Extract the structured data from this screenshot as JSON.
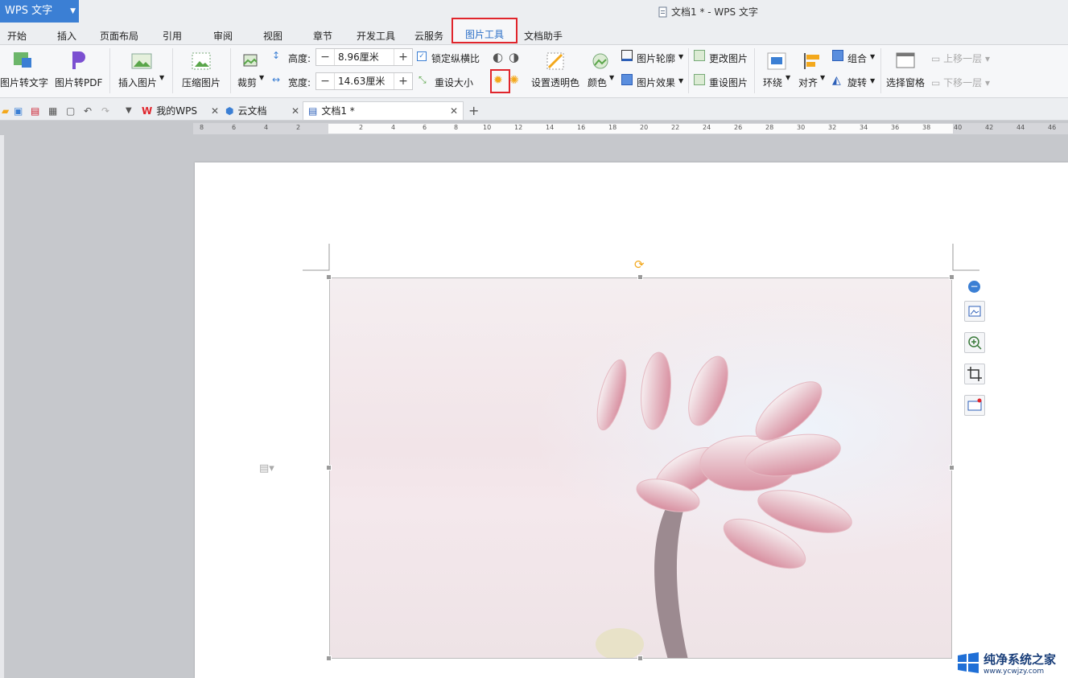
{
  "app": {
    "name": "WPS 文字",
    "window_title": "文档1 * - WPS 文字"
  },
  "menu_tabs": [
    "开始",
    "插入",
    "页面布局",
    "引用",
    "审阅",
    "视图",
    "章节",
    "开发工具",
    "云服务",
    "图片工具",
    "文档助手"
  ],
  "active_tab": "图片工具",
  "ribbon": {
    "img_to_text": "图片转文字",
    "img_to_pdf": "图片转PDF",
    "insert_image": "插入图片",
    "compress": "压缩图片",
    "crop": "裁剪",
    "height_label": "高度:",
    "height_value": "8.96厘米",
    "width_label": "宽度:",
    "width_value": "14.63厘米",
    "lock_ratio": "锁定纵横比",
    "reset_size": "重设大小",
    "set_transparent": "设置透明色",
    "color": "颜色",
    "outline": "图片轮廓",
    "effect": "图片效果",
    "change_image": "更改图片",
    "reset_image": "重设图片",
    "wrap": "环绕",
    "align": "对齐",
    "group": "组合",
    "rotate": "旋转",
    "select_pane": "选择窗格",
    "bring_forward": "上移一层",
    "send_backward": "下移一层"
  },
  "doc_tabs": [
    {
      "label": "我的WPS"
    },
    {
      "label": "云文档"
    },
    {
      "label": "文档1 *"
    }
  ],
  "ruler_numbers": [
    "8",
    "6",
    "4",
    "2",
    "2",
    "4",
    "6",
    "8",
    "10",
    "12",
    "14",
    "16",
    "18",
    "20",
    "22",
    "24",
    "26",
    "28",
    "30",
    "32",
    "34",
    "36",
    "38",
    "40",
    "42",
    "44",
    "46"
  ],
  "watermark": {
    "title": "纯净系统之家",
    "url": "www.ycwjzy.com"
  },
  "colors": {
    "accent": "#3b7fd4",
    "highlight": "#e0252c",
    "active_tab_text": "#2b6fc7"
  }
}
